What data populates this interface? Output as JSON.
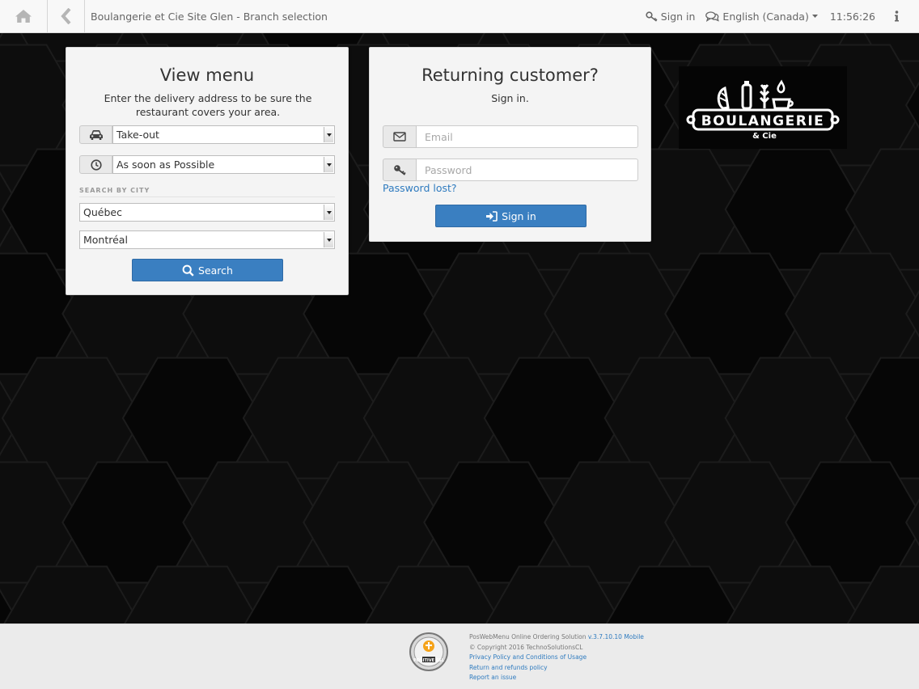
{
  "header": {
    "title": "Boulangerie et Cie Site Glen - Branch selection",
    "sign_in": "Sign in",
    "language": "English (Canada)",
    "time": "11:56:26"
  },
  "view_menu": {
    "title": "View menu",
    "subtitle": "Enter the delivery address to be sure the restaurant covers your area.",
    "order_type": "Take-out",
    "order_time": "As soon as Possible",
    "search_by_city_label": "SEARCH BY CITY",
    "province": "Québec",
    "city": "Montréal",
    "search_button": "Search"
  },
  "returning_customer": {
    "title": "Returning customer?",
    "subtitle": "Sign in.",
    "email_placeholder": "Email",
    "password_placeholder": "Password",
    "password_lost": "Password lost?",
    "sign_in_button": "Sign in"
  },
  "logo": {
    "text": "BOULANGERIE",
    "subtext": "& Cie"
  },
  "footer": {
    "product": "PosWebMenu Online Ordering Solution",
    "version": "v.3.7.10.10 Mobile",
    "copyright": "© Copyright 2016 TechnoSolutionsCL",
    "privacy": "Privacy Policy and Conditions of Usage",
    "refunds": "Return and refunds policy",
    "report": "Report an issue",
    "ssl_badge": "POSITIVE SSL"
  },
  "colors": {
    "primary": "#3a7fc1",
    "link": "#2f7bbf",
    "background": "#0e0e0e",
    "hex_stroke": "#1c1c1c"
  }
}
